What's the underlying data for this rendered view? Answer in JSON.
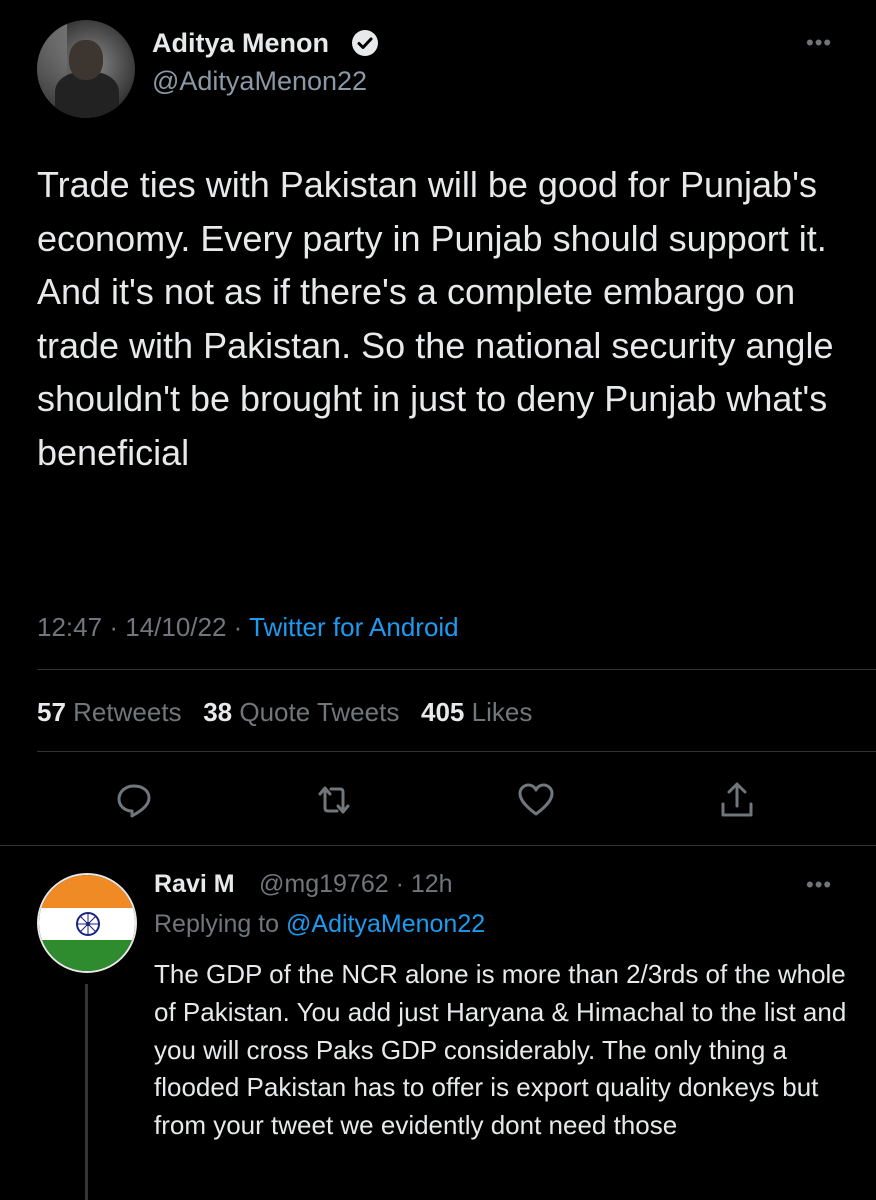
{
  "tweet": {
    "author": {
      "display_name": "Aditya Menon",
      "handle": "@AdityaMenon22",
      "verified": true
    },
    "more_icon": "more-horizontal-icon",
    "text": "Trade ties with Pakistan will be good for Punjab's economy. Every party in Punjab should support it. And it's not as if there's a complete embargo on trade with Pakistan. So the national security angle shouldn't be brought in just to deny Punjab what's beneficial",
    "time": "12:47",
    "date": "14/10/22",
    "separator": "·",
    "source": "Twitter for Android",
    "stats": {
      "retweets_count": "57",
      "retweets_label": "Retweets",
      "quote_count": "38",
      "quote_label": "Quote Tweets",
      "likes_count": "405",
      "likes_label": "Likes"
    },
    "actions": [
      "reply-icon",
      "retweet-icon",
      "like-icon",
      "share-icon"
    ]
  },
  "reply": {
    "display_name": "Ravi M",
    "handle": "@mg19762",
    "time": "12h",
    "separator": "·",
    "replying_prefix": "Replying to",
    "replying_to": "@AdityaMenon22",
    "text": "The GDP of the NCR alone is more than 2/3rds of the whole of Pakistan. You add just Haryana & Himachal to the list and you will cross Paks GDP considerably. The only thing a flooded Pakistan has to offer is export quality donkeys but from your tweet we evidently dont need those"
  },
  "colors": {
    "background": "#000000",
    "text": "#e7e9ea",
    "muted": "#71767b",
    "accent": "#1d9bf0",
    "flag_saffron": "#f08a24",
    "flag_white": "#ffffff",
    "flag_green": "#2e8b2e",
    "chakra": "#1a237e"
  }
}
